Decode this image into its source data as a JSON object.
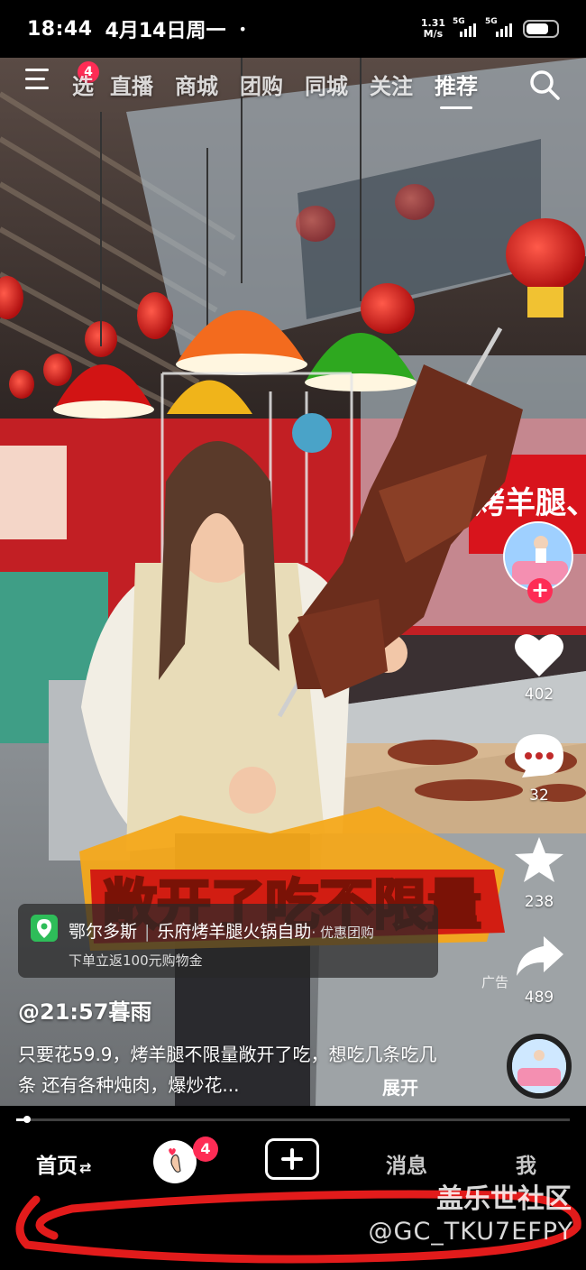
{
  "status_bar": {
    "time": "18:44",
    "date": "4月14日周一",
    "dot": "•",
    "net_speed_value": "1.31",
    "net_speed_unit": "M/s",
    "sim1": "5G",
    "sim2": "5G"
  },
  "top_nav": {
    "menu_badge": "4",
    "partial_tab": "选",
    "tabs": [
      "直播",
      "商城",
      "团购",
      "同城",
      "关注",
      "推荐"
    ],
    "active_tab": "推荐"
  },
  "video": {
    "banner_text": "敞开了吃不限量",
    "shop_sign": "烤羊腿、烤"
  },
  "right_rail": {
    "likes": "402",
    "comments": "32",
    "favorites": "238",
    "shares": "489",
    "ad_label": "广告"
  },
  "location_card": {
    "city": "鄂尔多斯",
    "shop": "乐府烤羊腿火锅自助",
    "tag": "· 优惠团购",
    "promo": "下单立返100元购物金"
  },
  "post": {
    "author": "@21:57暮雨",
    "description": "只要花59.9，烤羊腿不限量敞开了吃，想吃几条吃几条 还有各种炖肉，爆炒花...",
    "expand": "展开"
  },
  "progress": {
    "fraction": 0.02
  },
  "bottom_nav": {
    "home": "首页",
    "home_switch": "⇄",
    "friends_badge": "4",
    "messages": "消息",
    "me": "我"
  },
  "watermark": {
    "site": "盖乐世社区",
    "user": "@GC_TKU7EFPY"
  },
  "colors": {
    "accent_red": "#fe2c55",
    "location_green": "#2ebd59"
  }
}
